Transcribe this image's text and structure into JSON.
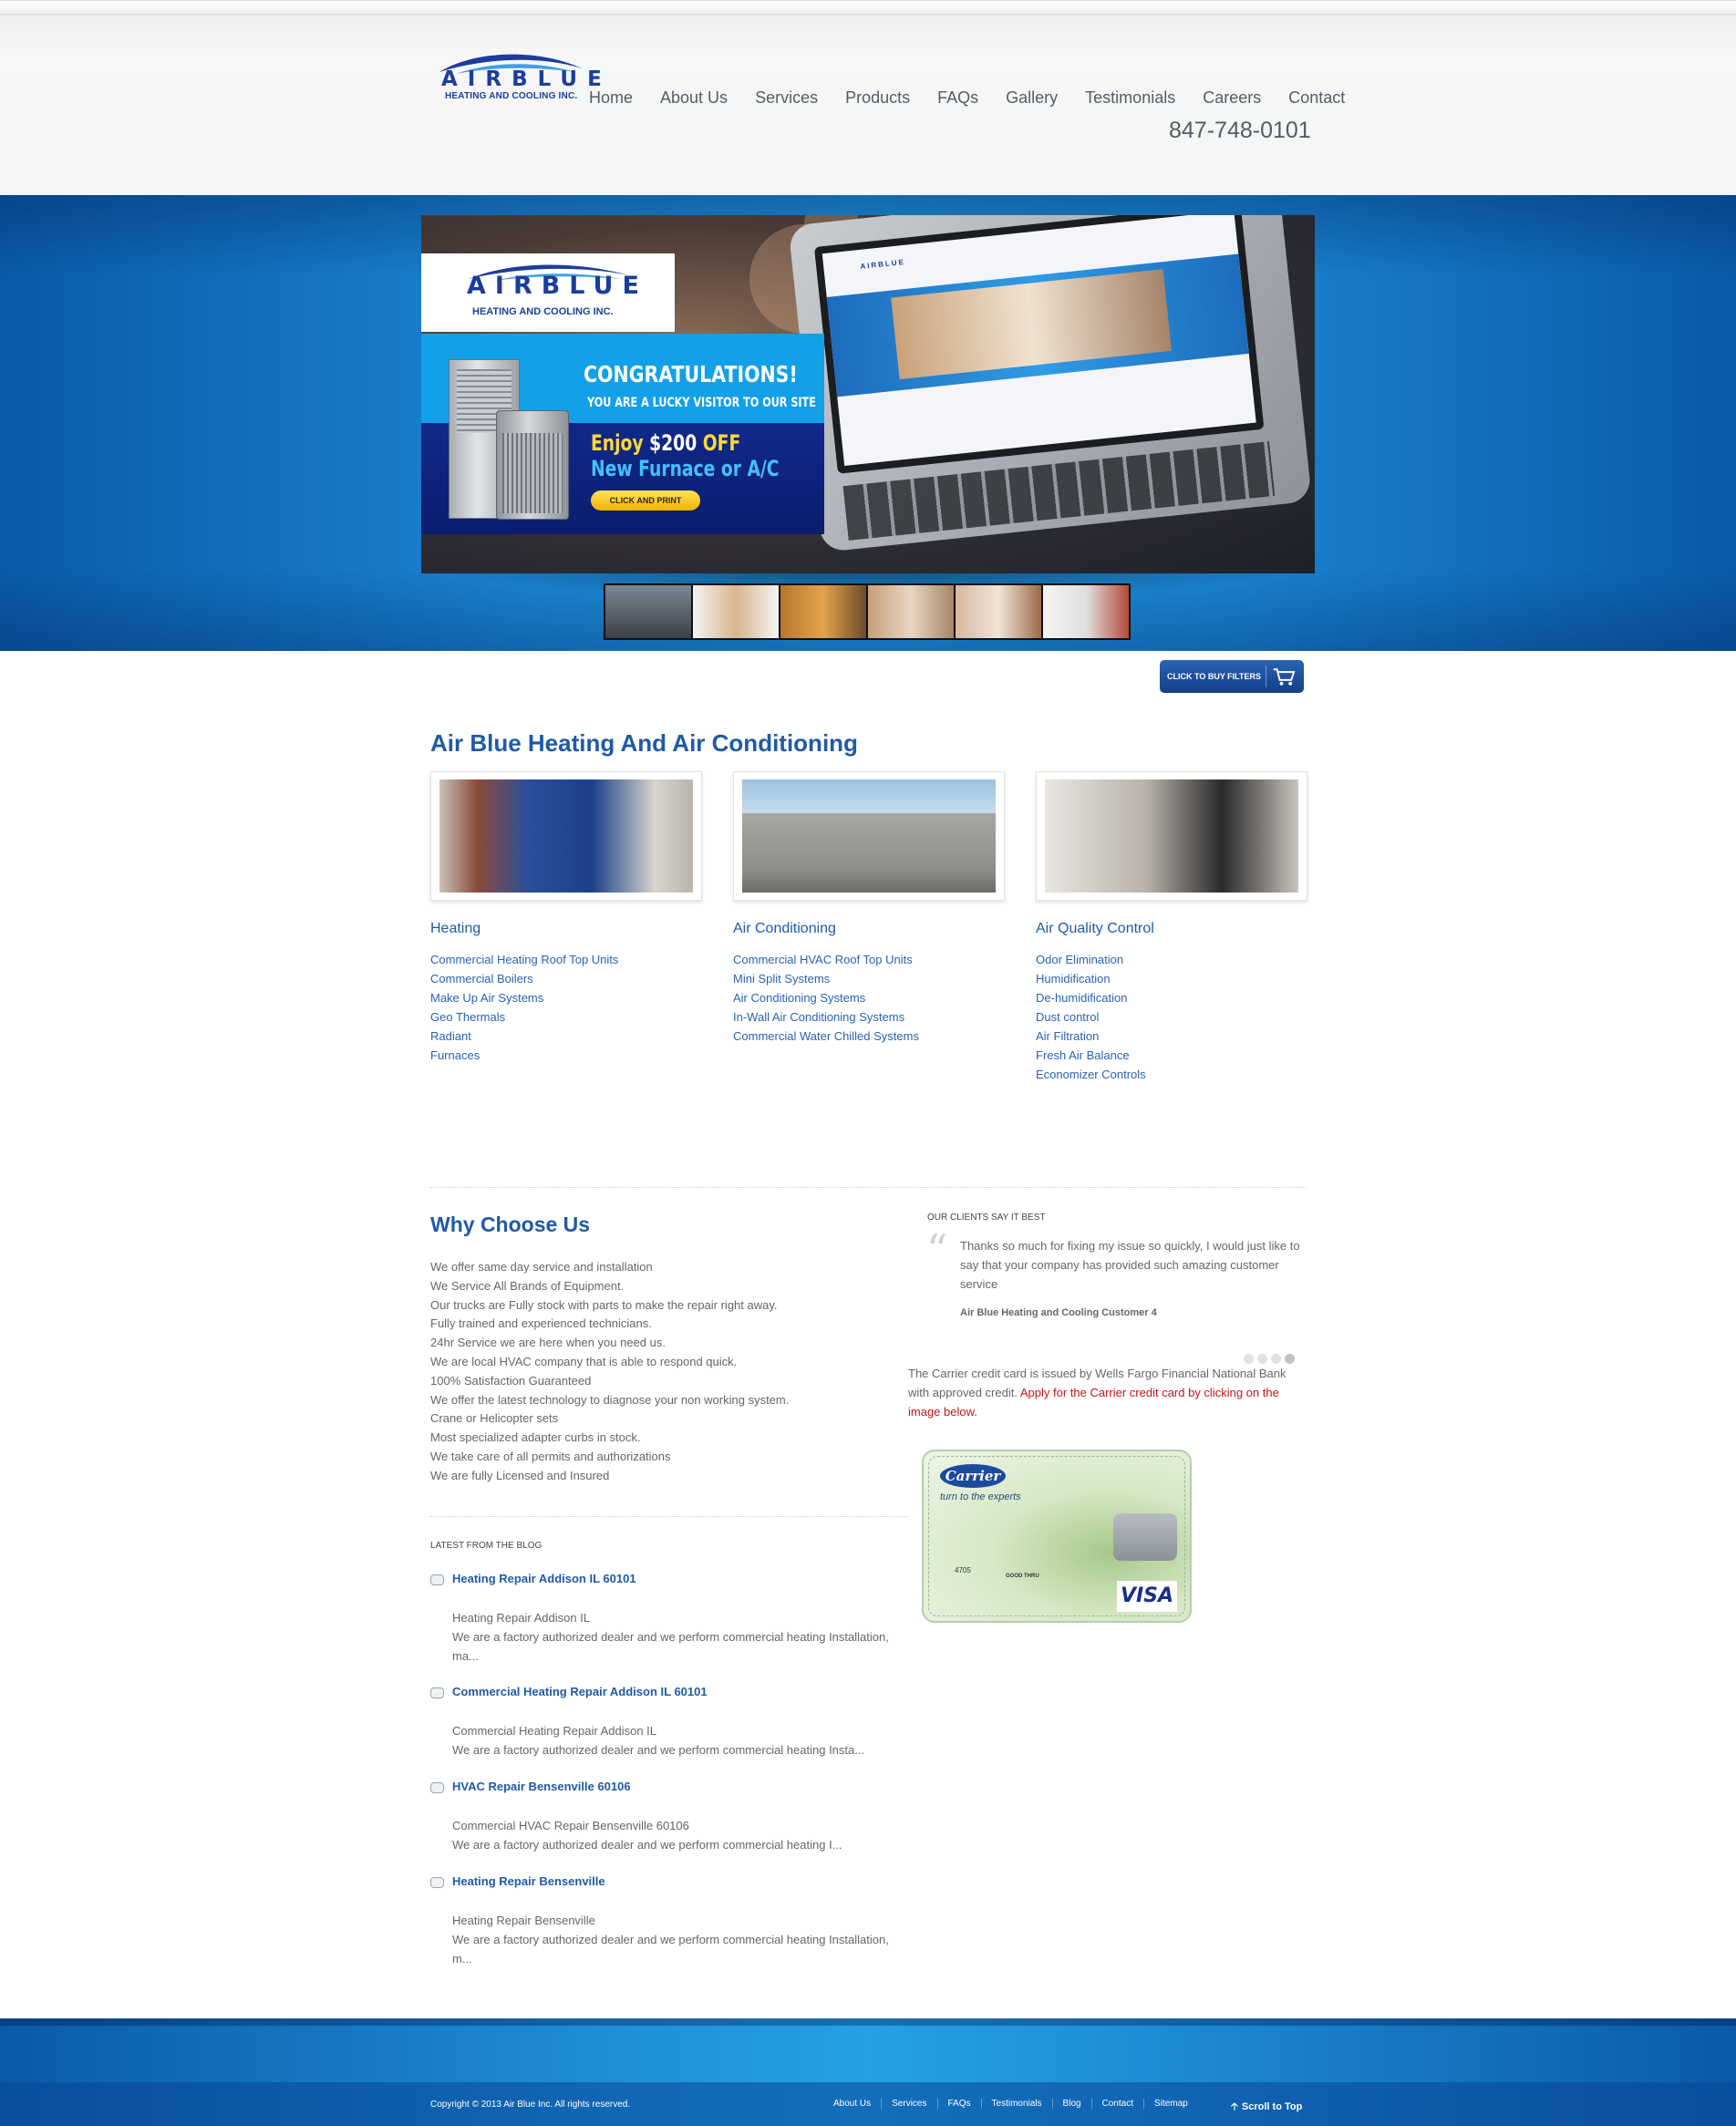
{
  "header": {
    "logo_word": "AIRBLUE",
    "logo_sub": "HEATING AND COOLING INC.",
    "nav": [
      "Home",
      "About Us",
      "Services",
      "Products",
      "FAQs",
      "Gallery",
      "Testimonials",
      "Careers",
      "Contact"
    ],
    "phone": "847-748-0101"
  },
  "slider": {
    "logo_word": "AIRBLUE",
    "logo_sub": "HEATING AND COOLING INC.",
    "congrats": "CONGRATULATIONS!",
    "lucky": "YOU ARE A LUCKY VISITOR TO OUR SITE",
    "enjoy_prefix": "Enjoy",
    "enjoy_amount": "$200",
    "enjoy_suffix": "OFF",
    "new_line": "New Furnace or A/C",
    "cta": "CLICK AND PRINT",
    "thumbnail_count": 6
  },
  "buy_filters": "CLICK TO BUY FILTERS",
  "services": {
    "title": "Air Blue Heating And Air Conditioning",
    "columns": [
      {
        "title": "Heating",
        "links": [
          "Commercial Heating Roof Top Units",
          "Commercial Boilers",
          "Make Up Air Systems",
          "Geo Thermals",
          "Radiant",
          "Furnaces"
        ]
      },
      {
        "title": "Air Conditioning",
        "links": [
          "Commercial HVAC Roof Top Units",
          "Mini Split Systems",
          "Air Conditioning Systems",
          "In-Wall Air Conditioning Systems",
          "Commercial Water Chilled Systems"
        ]
      },
      {
        "title": "Air Quality Control",
        "links": [
          "Odor Elimination",
          "Humidification",
          "De-humidification",
          "Dust control",
          "Air Filtration",
          "Fresh Air Balance",
          "Economizer Controls"
        ]
      }
    ]
  },
  "why": {
    "title": "Why Choose Us",
    "items": [
      "We offer same day service and installation",
      "We Service All Brands of Equipment.",
      "Our trucks are Fully stock with parts to make the repair right away.",
      "Fully trained and experienced technicians.",
      "24hr Service we are here when you need us.",
      "We are local HVAC company that is able to respond quick.",
      "100% Satisfaction Guaranteed",
      "We offer the latest technology to diagnose your non working system.",
      "Crane or Helicopter sets",
      "Most specialized adapter curbs in stock.",
      "We take care of all permits and authorizations",
      "We are fully Licensed and Insured"
    ]
  },
  "blog": {
    "heading": "LATEST FROM THE BLOG",
    "posts": [
      {
        "title": "Heating Repair Addison IL 60101",
        "line1": "Heating Repair Addison IL",
        "line2": "We are a factory authorized dealer and we perform commercial heating Installation, ma..."
      },
      {
        "title": "Commercial Heating Repair Addison IL 60101",
        "line1": "Commercial Heating Repair Addison IL",
        "line2": "We are a factory authorized dealer and we perform commercial heating Insta..."
      },
      {
        "title": "HVAC Repair Bensenville 60106",
        "line1": "Commercial HVAC Repair Bensenville 60106",
        "line2": "We are a factory authorized dealer and we perform commercial heating I..."
      },
      {
        "title": "Heating Repair Bensenville",
        "line1": "Heating Repair Bensenville",
        "line2": "We are a factory authorized dealer and we perform commercial heating Installation, m..."
      }
    ]
  },
  "testimonial": {
    "heading": "OUR CLIENTS SAY IT BEST",
    "quote": "Thanks so much for fixing my issue so quickly, I would just like to say that your company has provided such amazing customer service",
    "author": "Air Blue Heating and Cooling Customer 4",
    "dots_total": 4,
    "dots_active": 4
  },
  "carrier": {
    "note_plain": "The Carrier credit card is issued by Wells Fargo Financial National Bank with approved credit.",
    "note_red": "Apply for the Carrier credit card by clicking on the image below.",
    "card_brand": "Carrier",
    "card_tag": "turn to the experts",
    "card_number": "4705",
    "card_good": "GOOD THRU",
    "card_visa": "VISA"
  },
  "footer": {
    "copyright": "Copyright © 2013 Air Blue Inc. All rights reserved.",
    "links": [
      "About Us",
      "Services",
      "FAQs",
      "Testimonials",
      "Blog",
      "Contact",
      "Sitemap"
    ],
    "to_top": "Scroll to Top"
  },
  "colors": {
    "brand_blue": "#1f5aa6",
    "hero_blue": "#1f93df",
    "accent_red": "#c4141b",
    "cta_yellow": "#f2b300"
  }
}
